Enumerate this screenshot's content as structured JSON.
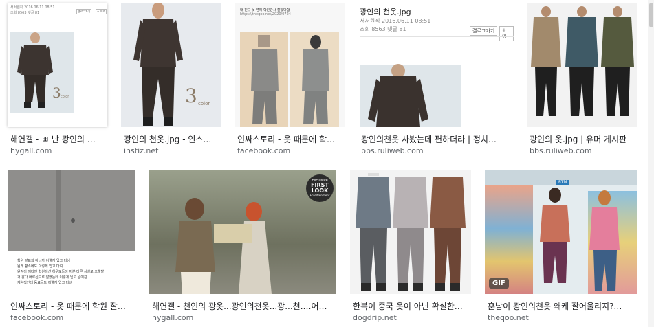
{
  "results": [
    {
      "caption": "해연갤 - ㅃ 난 광인의 …",
      "domain": "hygall.com"
    },
    {
      "caption": "광인의 천옷.jpg - 인스…",
      "domain": "instiz.net"
    },
    {
      "caption": "인싸스토리 - 옷 때문에 학…",
      "domain": "facebook.com"
    },
    {
      "caption": "광인의천옷 사봤는데 편하더라 | 정치…",
      "domain": "bbs.ruliweb.com"
    },
    {
      "caption": "광인의 옷.jpg | 유머 게시판",
      "domain": "bbs.ruliweb.com"
    },
    {
      "caption": "인싸스토리 - 옷 때문에 학원 잘…",
      "domain": "facebook.com"
    },
    {
      "caption": "해연갤 - 천인의 광옷...광인의천옷...광...천.…어…",
      "domain": "hygall.com"
    },
    {
      "caption": "한복이 중국 옷이 아닌 확실한…",
      "domain": "dogdrip.net"
    },
    {
      "caption": "훈남이 광인의천옷 왜케 잘어울리지?…",
      "domain": "theqoo.net"
    }
  ],
  "thumb1": {
    "header": "서서원직 2016.06.11 08:51",
    "sub": "조회 8563 댓글 81",
    "btn1": "갤로그가기",
    "btn2": "+ 이즈",
    "numeral": "3",
    "numeral_sub": "color"
  },
  "thumb2": {
    "numeral": "3",
    "numeral_sub": "color"
  },
  "thumb3": {
    "line1": "내 친구 옷 땜에 학원강사 잘렸다함",
    "line2": "https://theqoo.net/2020/0724"
  },
  "thumb4": {
    "title": "광인의 천옷.jpg",
    "meta1": "서서원직 2016.06.11 08:51",
    "meta2": "조회 8563 댓글 81",
    "btn1": "갤로그가기",
    "btn2": "+ 이"
  },
  "thumb6": {
    "lines": [
      "학원 발표회 하니까 이렇게 입고 다님",
      "원래 평소에도 이렇게 입고 다녀",
      "원장이 어디엔 학원에선 하우모들이 저분 다른 사실로 오해할",
      "거 같다 어르신으로 잘했는데 이렇게 입고 넘어감",
      "계약직인대 동료들도 이렇게 입고 다녀"
    ]
  },
  "thumb7": {
    "badge_top": "Exclusive",
    "badge_main": "FIRST LOOK",
    "badge_sub": "Entertainment"
  },
  "thumb9": {
    "gif": "GIF",
    "sign": "RTM"
  }
}
